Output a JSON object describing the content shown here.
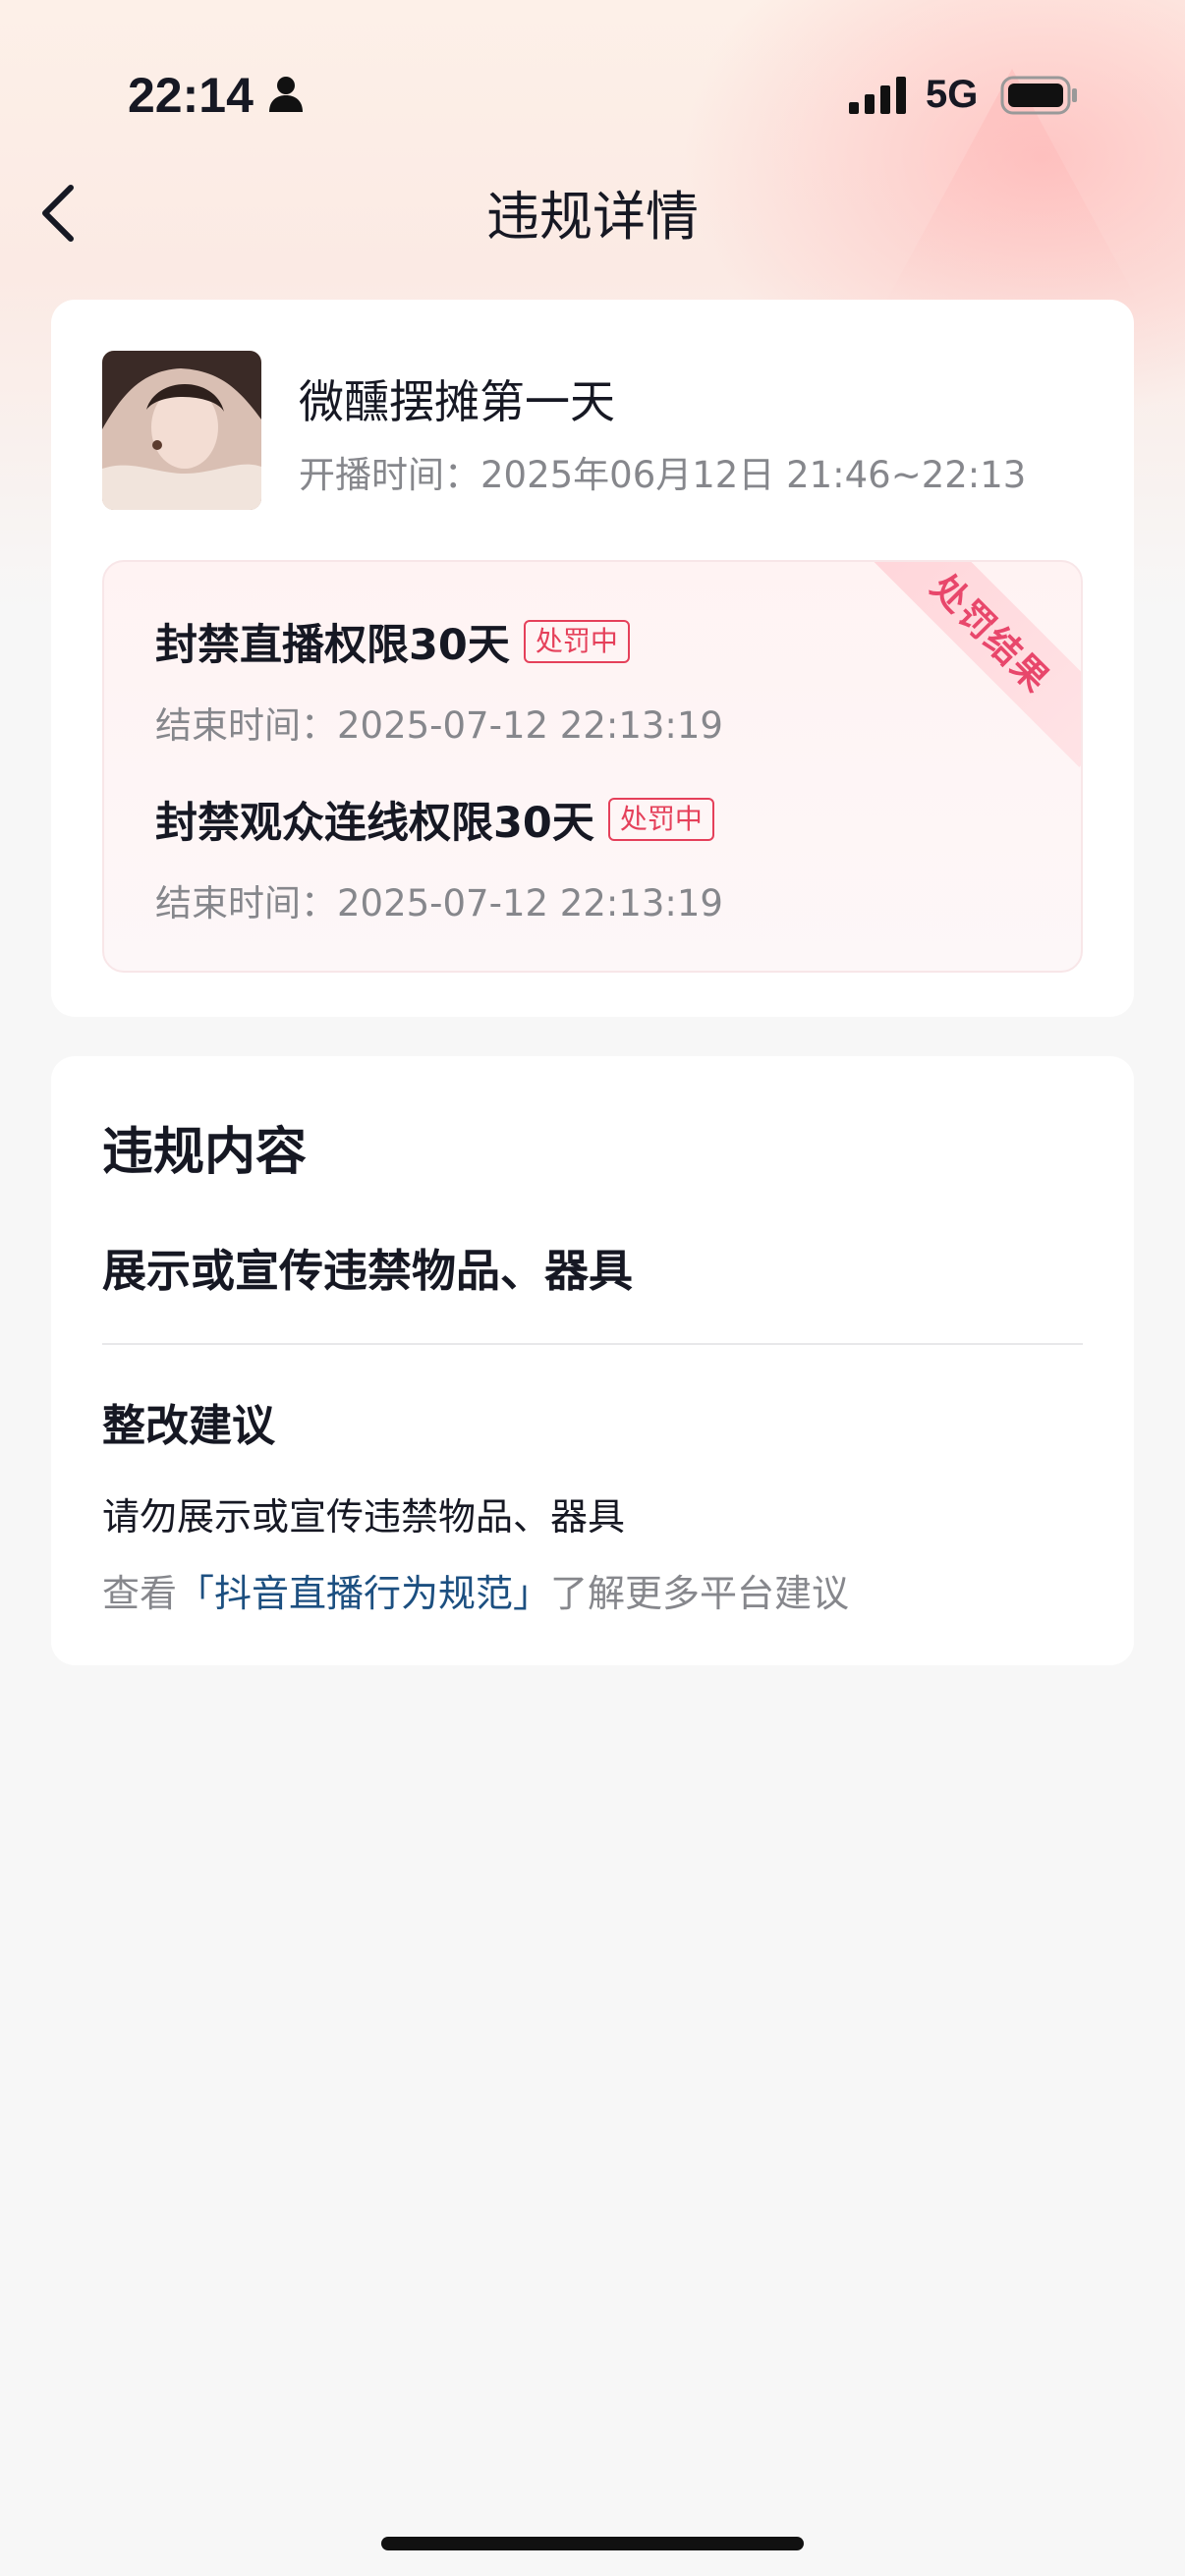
{
  "status_bar": {
    "time": "22:14",
    "network": "5G",
    "person_icon": "person-icon",
    "signal_icon": "signal-icon",
    "battery_icon": "battery-icon"
  },
  "nav": {
    "title": "违规详情",
    "back_icon": "chevron-left-icon"
  },
  "live": {
    "title": "微醺摆摊第一天",
    "time_label": "开播时间：",
    "time_value": "2025年06月12日 21:46~22:13"
  },
  "penalty": {
    "ribbon_label": "处罚结果",
    "items": [
      {
        "name": "封禁直播权限30天",
        "status": "处罚中",
        "end_label": "结束时间：",
        "end_value": "2025-07-12 22:13:19"
      },
      {
        "name": "封禁观众连线权限30天",
        "status": "处罚中",
        "end_label": "结束时间：",
        "end_value": "2025-07-12 22:13:19"
      }
    ]
  },
  "violation": {
    "heading": "违规内容",
    "content": "展示或宣传违禁物品、器具",
    "advice_heading": "整改建议",
    "advice_text": "请勿展示或宣传违禁物品、器具",
    "link_prefix": "查看",
    "link_text": "「抖音直播行为规范」",
    "link_suffix": "了解更多平台建议"
  },
  "colors": {
    "accent_red": "#e5405a",
    "link_blue": "#1c4f80",
    "muted_text": "#86878c"
  }
}
